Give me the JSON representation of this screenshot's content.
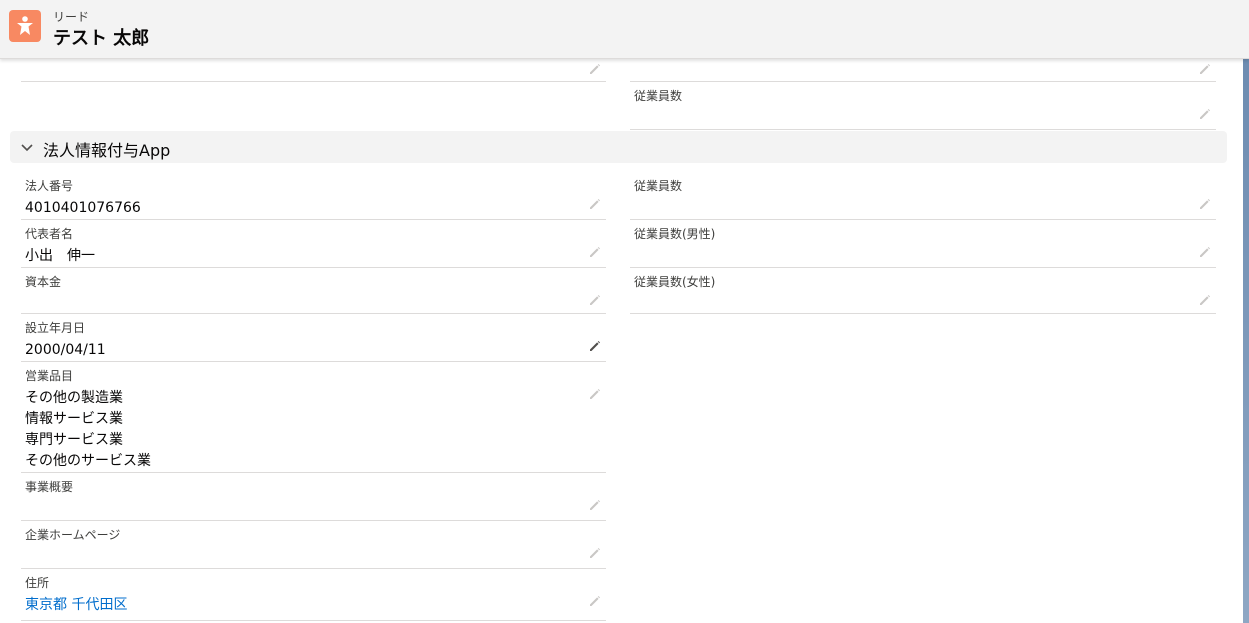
{
  "header": {
    "object_label": "リード",
    "record_name": "テスト 太郎",
    "icon": "lead-icon"
  },
  "top_section": {
    "right_field": {
      "label": "従業員数",
      "value": ""
    }
  },
  "section": {
    "title": "法人情報付与App",
    "toggle_icon": "chevron-down-icon"
  },
  "fields_left": [
    {
      "label": "法人番号",
      "value": "4010401076766"
    },
    {
      "label": "代表者名",
      "value": "小出　伸一"
    },
    {
      "label": "資本金",
      "value": ""
    },
    {
      "label": "設立年月日",
      "value": "2000/04/11"
    },
    {
      "label": "営業品目",
      "value": "その他の製造業\n情報サービス業\n専門サービス業\nその他のサービス業"
    },
    {
      "label": "事業概要",
      "value": ""
    },
    {
      "label": "企業ホームページ",
      "value": ""
    },
    {
      "label": "住所",
      "value": "東京都 千代田区"
    }
  ],
  "fields_right": [
    {
      "label": "従業員数",
      "value": ""
    },
    {
      "label": "従業員数(男性)",
      "value": ""
    },
    {
      "label": "従業員数(女性)",
      "value": ""
    }
  ],
  "colors": {
    "accent_link": "#006dcc",
    "lead_icon_bg": "#f88962",
    "header_bg": "#f3f3f3",
    "divider": "#dddbda"
  }
}
